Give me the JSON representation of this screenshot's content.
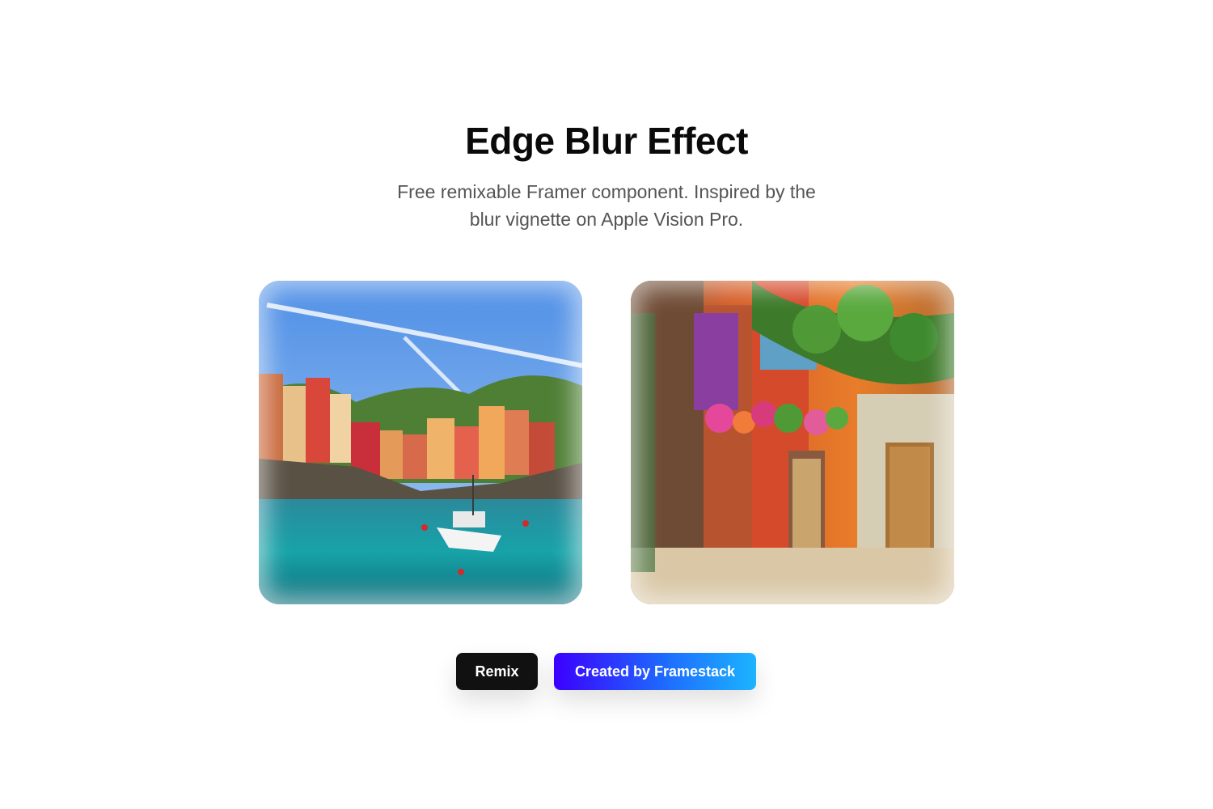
{
  "header": {
    "title": "Edge Blur Effect",
    "subtitle": "Free remixable Framer component. Inspired by the blur vignette on Apple Vision Pro."
  },
  "gallery": [
    {
      "icon": "coastal-village-image"
    },
    {
      "icon": "colorful-street-image"
    }
  ],
  "actions": {
    "remix_label": "Remix",
    "credit_label": "Created by Framestack"
  },
  "colors": {
    "remix_bg": "#111111",
    "credit_gradient_start": "#3b00ff",
    "credit_gradient_end": "#1cb4ff"
  }
}
